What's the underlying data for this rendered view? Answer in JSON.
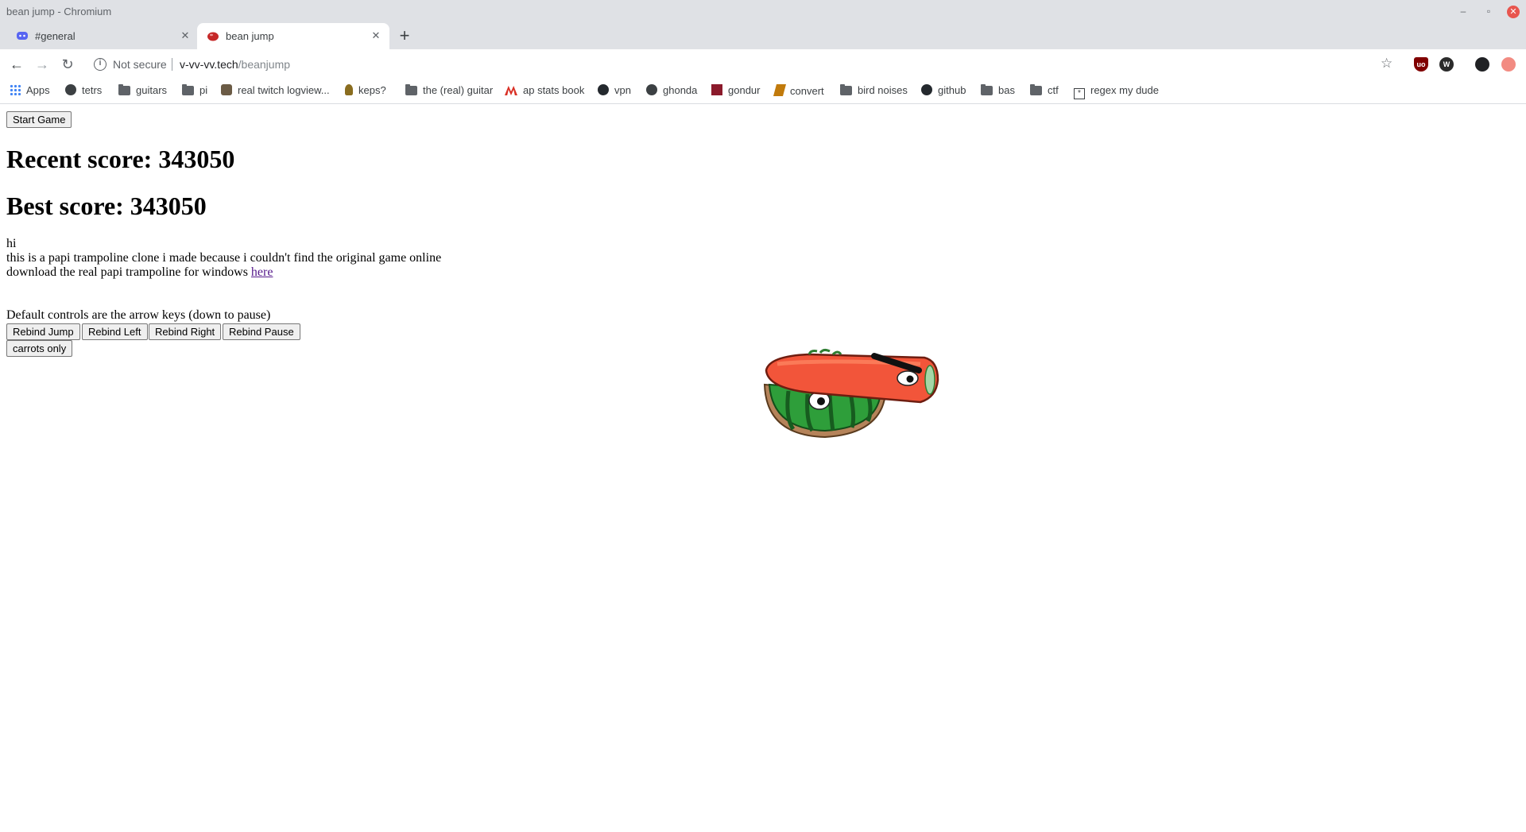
{
  "window": {
    "title": "bean jump - Chromium",
    "controls": {
      "minimize": "–",
      "maximize": "▫",
      "close": "✕"
    }
  },
  "tabs": [
    {
      "title": "#general",
      "icon": "discord-icon",
      "active": false,
      "close": "✕"
    },
    {
      "title": "bean jump",
      "icon": "bean-favicon",
      "active": true,
      "close": "✕"
    }
  ],
  "newtab": "+",
  "toolbar": {
    "back": "←",
    "forward": "→",
    "reload": "↻",
    "info": "i",
    "security": "Not secure",
    "host": "v-vv-vv.tech",
    "path": "/beanjump",
    "star": "☆",
    "extensions": [
      "uo",
      "W",
      "",
      ""
    ]
  },
  "bookmarks": [
    {
      "label": "Apps",
      "icon": "apps"
    },
    {
      "label": "tetrs",
      "icon": "globe"
    },
    {
      "label": "guitars",
      "icon": "folder"
    },
    {
      "label": "pi",
      "icon": "folder"
    },
    {
      "label": "real twitch logview...",
      "icon": "twitch"
    },
    {
      "label": "keps?",
      "icon": "keps"
    },
    {
      "label": "the (real) guitar",
      "icon": "folder"
    },
    {
      "label": "ap stats book",
      "icon": "ap"
    },
    {
      "label": "vpn",
      "icon": "gh"
    },
    {
      "label": "ghonda",
      "icon": "globe"
    },
    {
      "label": "gondur",
      "icon": "gondur"
    },
    {
      "label": "convert",
      "icon": "convert"
    },
    {
      "label": "bird noises",
      "icon": "folder"
    },
    {
      "label": "github",
      "icon": "gh"
    },
    {
      "label": "bas",
      "icon": "folder"
    },
    {
      "label": "ctf",
      "icon": "folder"
    },
    {
      "label": "regex my dude",
      "icon": "regex"
    }
  ],
  "page": {
    "start_button": "Start Game",
    "recent_score": "Recent score: 343050",
    "best_score": "Best score: 343050",
    "intro_line1": "hi",
    "intro_line2": "this is a papi trampoline clone i made because i couldn't find the original game online",
    "intro_line3_prefix": "download the real papi trampoline for windows ",
    "intro_link": "here",
    "controls_note": "Default controls are the arrow keys (down to pause)",
    "rebind_jump": "Rebind Jump",
    "rebind_left": "Rebind Left",
    "rebind_right": "Rebind Right",
    "rebind_pause": "Rebind Pause",
    "carrots_only": "carrots only"
  },
  "colors": {
    "carrot": "#f2553a",
    "melon": "#2e9e3a",
    "link": "#551a8b"
  }
}
